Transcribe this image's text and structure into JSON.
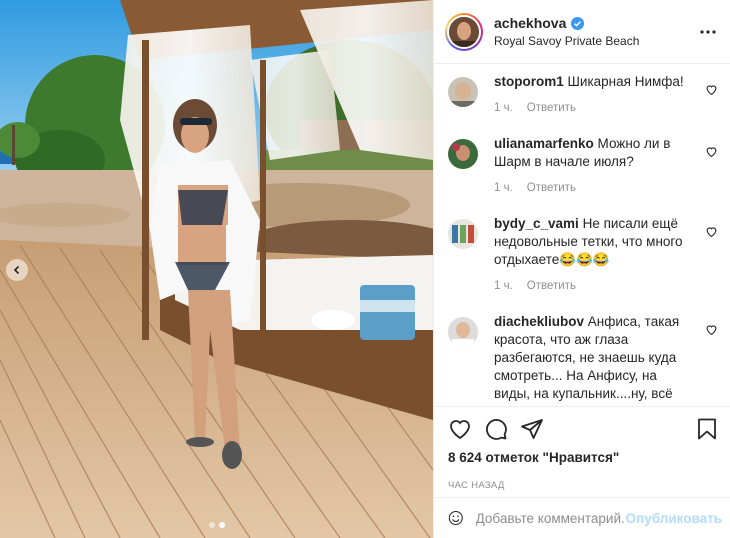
{
  "post": {
    "author": "achekhova",
    "location": "Royal Savoy Private Beach",
    "verified": true,
    "photo_description_icon": "beach-photo"
  },
  "comments": [
    {
      "user": "stoporom1",
      "text": "Шикарная Нимфа!",
      "time": "1 ч.",
      "reply": "Ответить"
    },
    {
      "user": "ulianamarfenko",
      "text": "Можно ли в Шарм в начале июля?",
      "time": "1 ч.",
      "reply": "Ответить"
    },
    {
      "user": "bydy_c_vami",
      "text": "Не писали ещё недовольные тетки, что много отдыхаете😂😂😂",
      "time": "1 ч.",
      "reply": "Ответить"
    },
    {
      "user": "diachekliubov",
      "text": "Анфиса, такая красота, что аж глаза разбегаются, не знаешь куда смотреть... На Анфису, на виды, на купальник....ну, всё очень"
    }
  ],
  "actions": {
    "likes": "8 624 отметок \"Нравится\"",
    "time_ago": "час назад"
  },
  "composer": {
    "placeholder": "Добавьте комментарий...",
    "post_label": "Опубликовать"
  },
  "colors": {
    "link": "#0095f6",
    "post_disabled": "#b3dbff",
    "verified": "#3897f0",
    "text": "#262626",
    "muted": "#8e8e8e"
  }
}
